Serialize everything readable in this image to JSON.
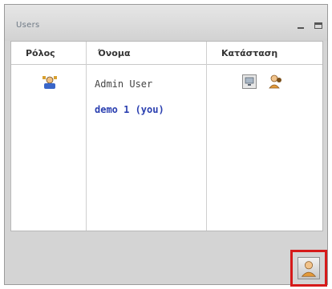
{
  "window": {
    "title": "Users"
  },
  "table": {
    "headers": [
      "Ρόλος",
      "Όνομα",
      "Κατάσταση"
    ],
    "rows": [
      {
        "role_icon": "admin-role-icon",
        "name": "Admin User",
        "status_icons": [
          "monitor-icon",
          "user-status-icon"
        ]
      },
      {
        "role_icon": "",
        "name": "demo 1 (you)",
        "status_icons": []
      }
    ]
  },
  "footer": {
    "button_icon": "user-settings-icon"
  },
  "colors": {
    "accent_link": "#2a3fb0",
    "highlight_border": "#d61a1a"
  }
}
